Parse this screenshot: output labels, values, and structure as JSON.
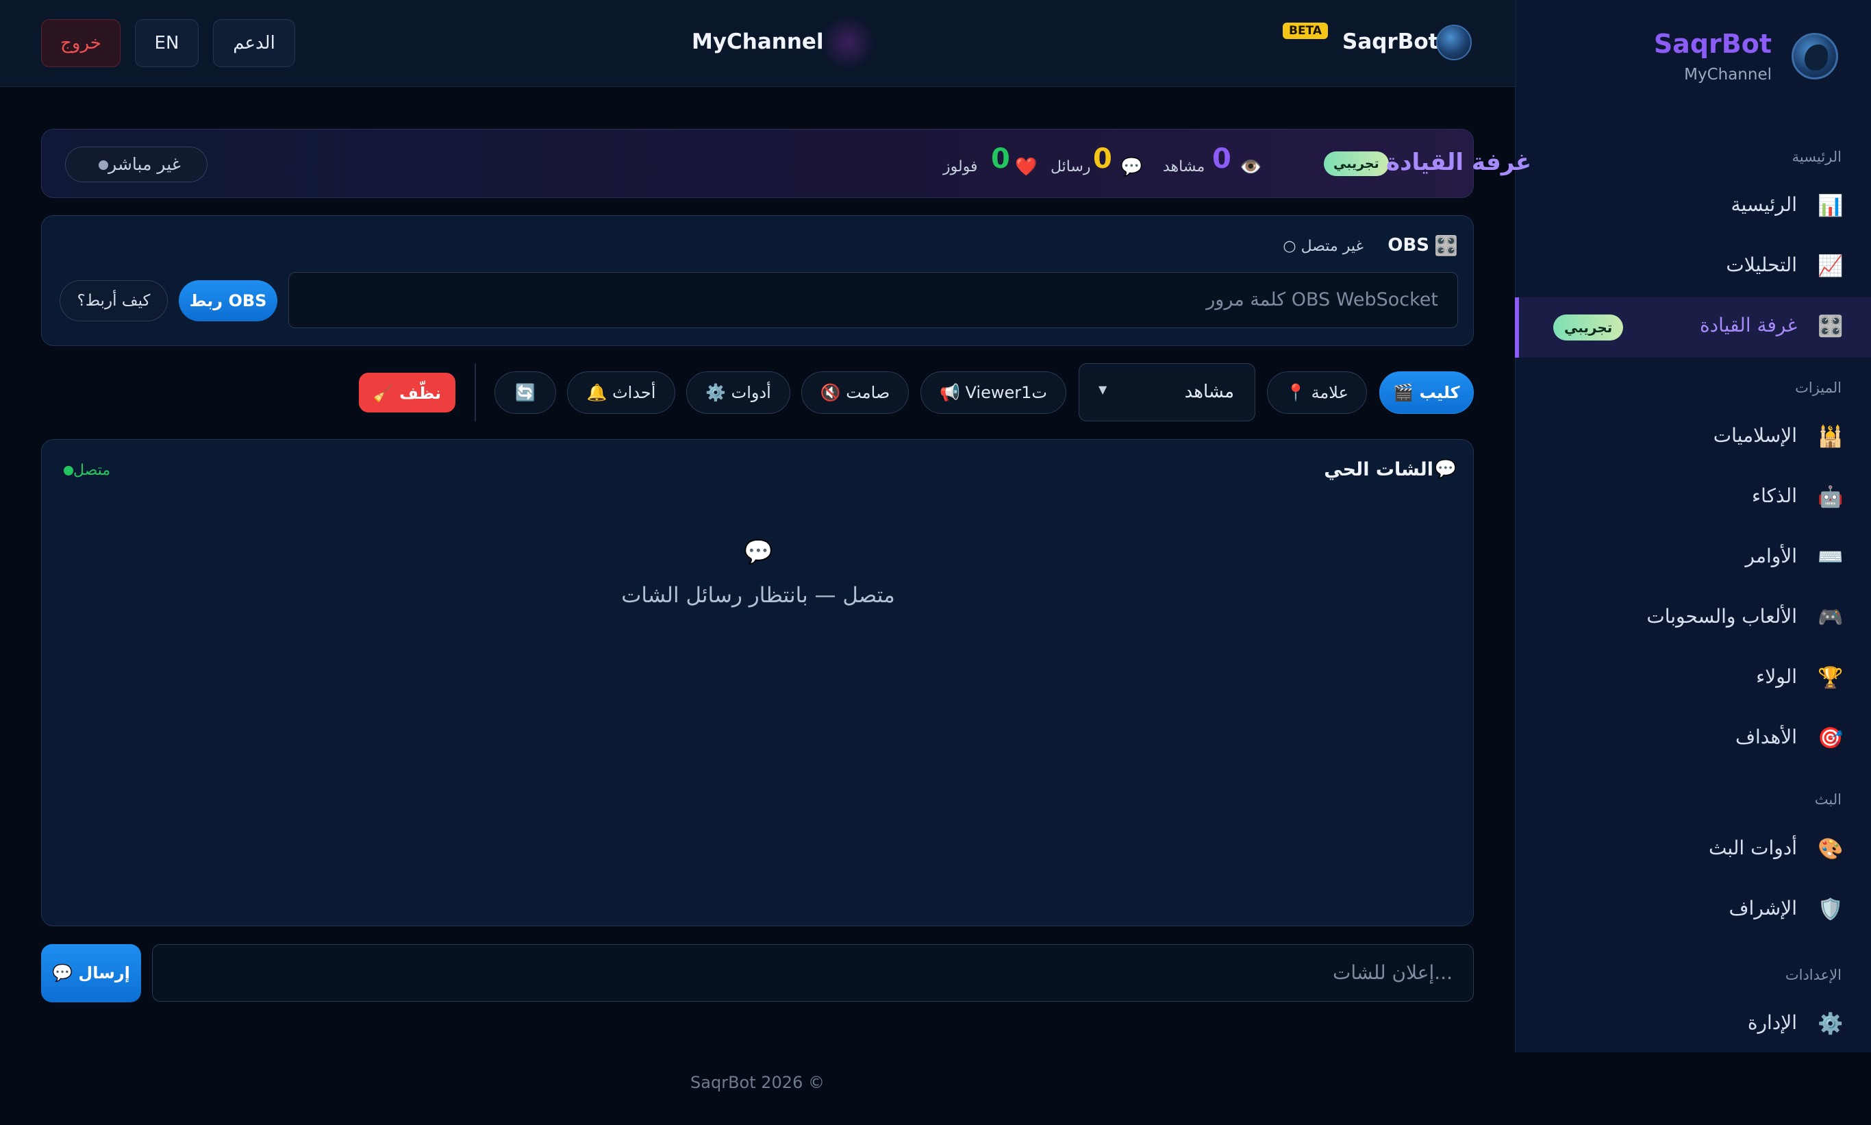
{
  "sidebar": {
    "brand": "SaqrBot",
    "channel": "MyChannel",
    "sections": [
      "الرئيسية",
      "الميزات",
      "البث",
      "الإعدادات"
    ],
    "items": [
      {
        "label": "الرئيسية",
        "icon": "📊"
      },
      {
        "label": "التحليلات",
        "icon": "📈"
      },
      {
        "label": "غرفة القيادة",
        "icon": "🎛️",
        "badge": "تجريبي"
      },
      {
        "label": "الإسلاميات",
        "icon": "🕌"
      },
      {
        "label": "الذكاء",
        "icon": "🤖"
      },
      {
        "label": "الأوامر",
        "icon": "⌨️"
      },
      {
        "label": "الألعاب والسحوبات",
        "icon": "🎮"
      },
      {
        "label": "الولاء",
        "icon": "🏆"
      },
      {
        "label": "الأهداف",
        "icon": "🎯"
      },
      {
        "label": "أدوات البث",
        "icon": "🎨"
      },
      {
        "label": "الإشراف",
        "icon": "🛡️"
      },
      {
        "label": "الإدارة",
        "icon": "⚙️"
      }
    ]
  },
  "topbar": {
    "logout": "خروج",
    "lang": "EN",
    "support": "الدعم",
    "channel": "MyChannel",
    "brand": "SaqrBot",
    "beta": "BETA"
  },
  "stats": {
    "title": "غرفة القيادة",
    "badge": "تجريبي",
    "live_status": "غير مباشر",
    "viewers": {
      "value": "0",
      "label": "مشاهد",
      "icon": "👁️"
    },
    "messages": {
      "value": "0",
      "label": "رسائل",
      "icon": "💬"
    },
    "follows": {
      "value": "0",
      "label": "فولوز",
      "icon": "❤️"
    }
  },
  "obs": {
    "title": "OBS",
    "icon": "🎛️",
    "status": "○ غير متصل",
    "placeholder": "كلمة مرور OBS WebSocket",
    "connect": "ربط OBS",
    "how": "كيف أربط؟"
  },
  "toolbar": {
    "clip": "🎬 كليب",
    "marker": "📍 علامة",
    "viewer_select": "مشاهد",
    "shoutout": "📢 Viewer1ت",
    "mute": "🔇 صامت",
    "tools": "⚙️ أدوات",
    "events": "🔔 أحداث",
    "refresh": "🔄",
    "clean": "🧹 نظّف"
  },
  "chat": {
    "title": "الشات الحي",
    "icon": "💬",
    "status": "متصل",
    "empty_icon": "💬",
    "empty_text": "متصل — بانتظار رسائل الشات",
    "announce_placeholder": "إعلان للشات...",
    "send": "💬 إرسال"
  },
  "footer": "SaqrBot 2026 ©",
  "colors": {
    "accent": "#8b5cf6",
    "primary": "#1f8ef0",
    "danger": "#ef3e3e",
    "success": "#22c55e",
    "beta": "#f5c518"
  }
}
